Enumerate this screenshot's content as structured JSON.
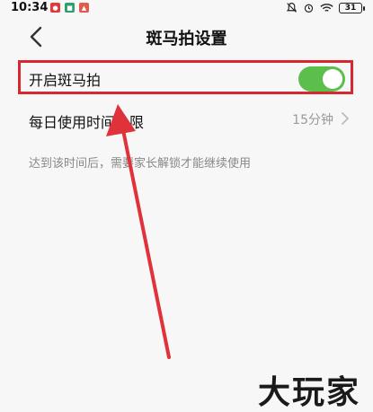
{
  "status_bar": {
    "time": "10:34",
    "apps": [
      {
        "label": "",
        "color": "#e23a3a"
      },
      {
        "label": "",
        "color": "#2e9e6a"
      },
      {
        "label": "",
        "color": "#e45a4a"
      }
    ],
    "battery": "31"
  },
  "nav": {
    "title": "斑马拍设置"
  },
  "settings": {
    "toggle_label": "开启斑马拍",
    "toggle_on": true,
    "limit_label": "每日使用时间上限",
    "limit_value": "15分钟",
    "hint": "达到该时间后，需要家长解锁才能继续使用"
  },
  "watermark": "大玩家",
  "colors": {
    "toggle_on": "#5cbf4c",
    "highlight": "#d7282f",
    "arrow": "#e0323a"
  }
}
